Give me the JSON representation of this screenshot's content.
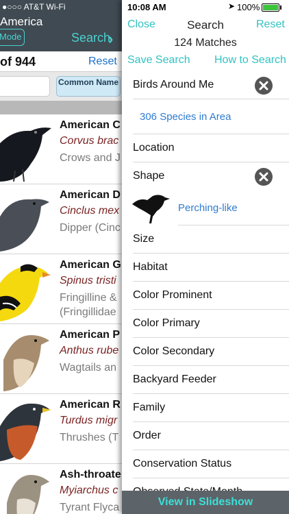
{
  "background": {
    "status": {
      "carrier": "●○○○ AT&T Wi-Fi"
    },
    "header": {
      "title": "America",
      "mode_label": "Mode",
      "search_label": "Search",
      "chevron_icon": "chevron-right-icon"
    },
    "count_bar": {
      "count": "of 944",
      "reset": "Reset"
    },
    "filter_bar": {
      "common_name": "Common Name"
    },
    "birds": [
      {
        "name": "American C",
        "sci": "Corvus brac",
        "family": "Crows and J"
      },
      {
        "name": "American D",
        "sci": "Cinclus mex",
        "family": "Dipper (Cinc"
      },
      {
        "name": "American G",
        "sci": "Spinus tristi",
        "family": "Fringilline &\n(Fringillidae"
      },
      {
        "name": "American P",
        "sci": "Anthus rube",
        "family": "Wagtails an"
      },
      {
        "name": "American R",
        "sci": "Turdus migr",
        "family": "Thrushes (T"
      },
      {
        "name": "Ash-throate",
        "sci": "Myiarchus c",
        "family": "Tyrant Flyca"
      }
    ]
  },
  "panel": {
    "status": {
      "time": "10:08 AM",
      "battery": "100%",
      "battery_color": "#3cc43c"
    },
    "nav": {
      "close": "Close",
      "title": "Search",
      "reset": "Reset"
    },
    "matches": "124 Matches",
    "save_search": "Save Search",
    "how_to_search": "How to Search",
    "birds_around_me": "Birds Around Me",
    "species_in_area": "306 Species in Area",
    "location": "Location",
    "shape": "Shape",
    "shape_value": "Perching-like",
    "filters": [
      "Size",
      "Habitat",
      "Color Prominent",
      "Color Primary",
      "Color Secondary",
      "Backyard Feeder",
      "Family",
      "Order",
      "Conservation Status",
      "Observed State/Month"
    ],
    "footer": "View in Slideshow",
    "accent_color": "#33c1c1",
    "link_color": "#2f7bd0"
  }
}
